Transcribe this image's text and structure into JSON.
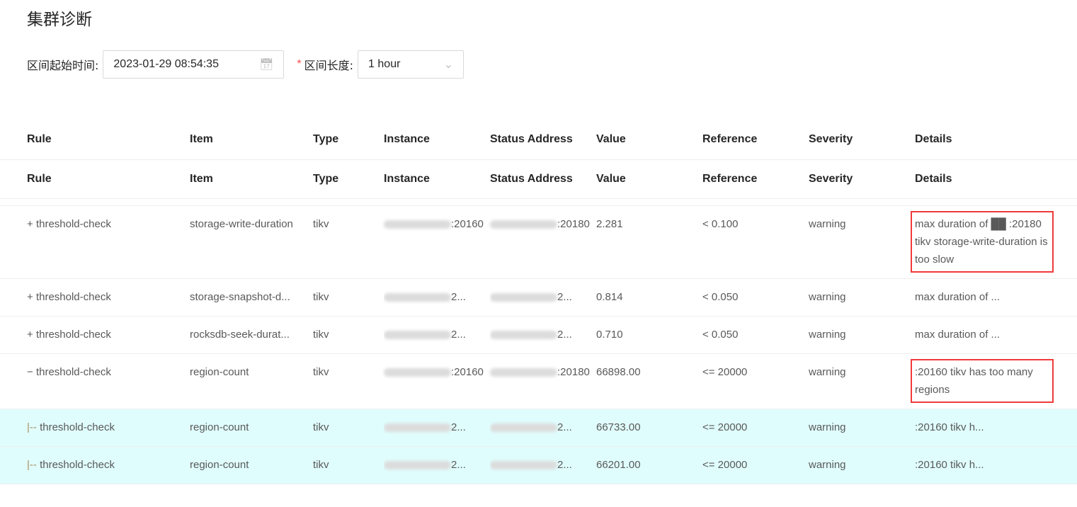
{
  "title": "集群诊断",
  "form": {
    "start_label": "区间起始时间:",
    "start_value": "2023-01-29 08:54:35",
    "length_label": "区间长度:",
    "length_value": "1 hour",
    "required_mark": "*"
  },
  "columns": [
    "Rule",
    "Item",
    "Type",
    "Instance",
    "Status Address",
    "Value",
    "Reference",
    "Severity",
    "Details"
  ],
  "rows": [
    {
      "prefix": "+",
      "rule": "threshold-check",
      "item": "storage-write-duration",
      "type": "tikv",
      "instance": ":20160",
      "status": ":20180",
      "value": "2.281",
      "reference": "< 0.100",
      "severity": "warning",
      "details": "max duration of ██ :20180 tikv storage-write-duration is too slow",
      "highlight": true,
      "sub": false,
      "trunc": false
    },
    {
      "prefix": "+",
      "rule": "threshold-check",
      "item": "storage-snapshot-d...",
      "type": "tikv",
      "instance": "2...",
      "status": "2...",
      "value": "0.814",
      "reference": "< 0.050",
      "severity": "warning",
      "details": "max duration of ...",
      "highlight": false,
      "sub": false,
      "trunc": true
    },
    {
      "prefix": "+",
      "rule": "threshold-check",
      "item": "rocksdb-seek-durat...",
      "type": "tikv",
      "instance": "2...",
      "status": "2...",
      "value": "0.710",
      "reference": "< 0.050",
      "severity": "warning",
      "details": "max duration of ...",
      "highlight": false,
      "sub": false,
      "trunc": true
    },
    {
      "prefix": "−",
      "rule": "threshold-check",
      "item": "region-count",
      "type": "tikv",
      "instance": ":20160",
      "status": ":20180",
      "value": "66898.00",
      "reference": "<= 20000",
      "severity": "warning",
      "details": ":20160 tikv has too many regions",
      "highlight": true,
      "sub": false,
      "trunc": false
    },
    {
      "prefix": "|--",
      "rule": "threshold-check",
      "item": "region-count",
      "type": "tikv",
      "instance": "2...",
      "status": "2...",
      "value": "66733.00",
      "reference": "<= 20000",
      "severity": "warning",
      "details": ":20160 tikv h...",
      "highlight": false,
      "sub": true,
      "trunc": true
    },
    {
      "prefix": "|--",
      "rule": "threshold-check",
      "item": "region-count",
      "type": "tikv",
      "instance": "2...",
      "status": "2...",
      "value": "66201.00",
      "reference": "<= 20000",
      "severity": "warning",
      "details": ":20160 tikv h...",
      "highlight": false,
      "sub": true,
      "trunc": true
    }
  ]
}
